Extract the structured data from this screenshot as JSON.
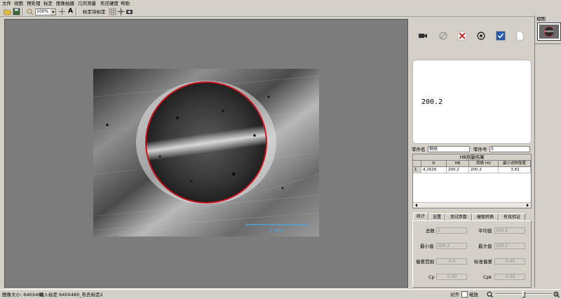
{
  "menu": {
    "file": "文件",
    "view": "视图",
    "preprocess": "预处理",
    "calibrate": "标定",
    "capture": "图像拍摄",
    "geometry": "几何测量",
    "hardness": "布氏硬度",
    "help": "帮助"
  },
  "toolbar": {
    "zoom_value": "100%",
    "text_tool": "A",
    "calibrate_block": "标定块标定"
  },
  "scale_bar": {
    "label": "2 mm"
  },
  "readout": {
    "value": "200.2"
  },
  "part": {
    "name_label": "零件名",
    "name_value": "钢块",
    "number_label": "零件号",
    "number_value": "0"
  },
  "results": {
    "title": "HB测量结果",
    "columns": [
      "",
      "D",
      "HB",
      "转换 HV",
      "最小试样厚度"
    ],
    "rows": [
      [
        "1",
        "4.2626",
        "200.2",
        "200.2",
        "3.82"
      ]
    ]
  },
  "tabs": [
    "统计",
    "设置",
    "测试参数",
    "硬度转换",
    "有效验证"
  ],
  "stats": {
    "total_label": "总数",
    "total_value": "1",
    "mean_label": "平均值",
    "mean_value": "200.2",
    "min_label": "最小值",
    "min_value": "200.2",
    "max_label": "最大值",
    "max_value": "200.2",
    "range_label": "偏差范围",
    "range_value": "0.0",
    "std_label": "标准偏差",
    "std_value": "0.00",
    "cp_label": "Cp",
    "cp_value": "0.00",
    "cpk_label": "Cpk",
    "cpk_value": "0.00"
  },
  "thumbnails": {
    "label": "相图"
  },
  "status": {
    "image_size": "图像大小: 640X480",
    "loaded_calibration": "载入标定 640X480_布氏标定2",
    "align_label": "对齐",
    "zoom_label": "缩放"
  },
  "colors": {
    "measure_circle": "#c8141e",
    "scale_bar": "#4aa3d8",
    "window_bg": "#d4d0c8",
    "viewport_bg": "#7c7c7c"
  }
}
